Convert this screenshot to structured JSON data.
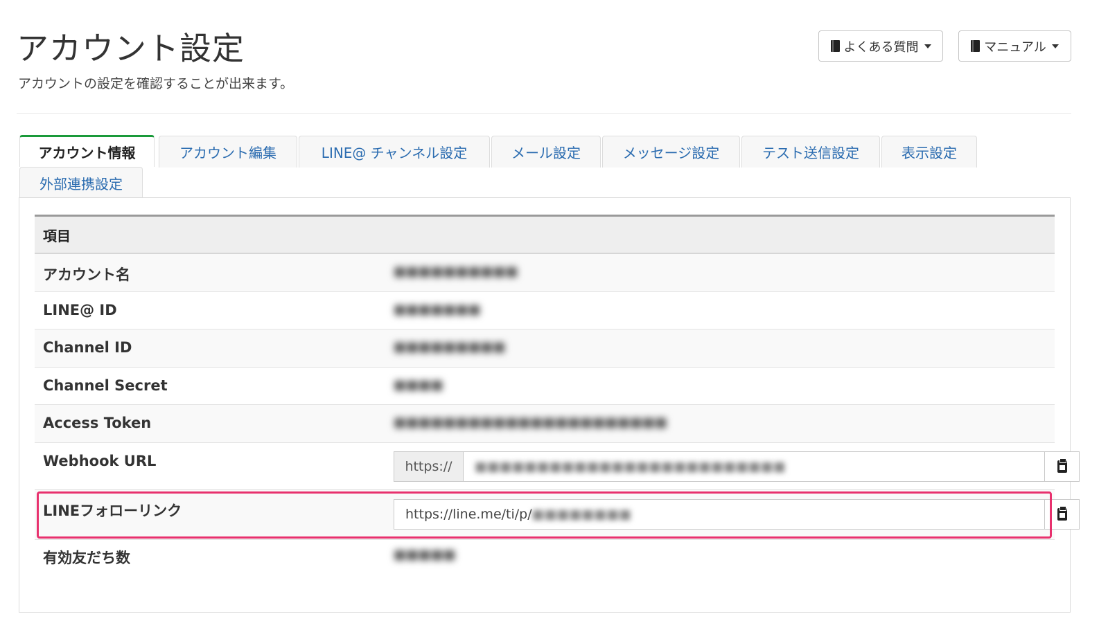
{
  "header": {
    "title": "アカウント設定",
    "description": "アカウントの設定を確認することが出来ます。",
    "faq_label": "よくある質問",
    "manual_label": "マニュアル"
  },
  "tabs": [
    {
      "label": "アカウント情報",
      "active": true
    },
    {
      "label": "アカウント編集"
    },
    {
      "label": "LINE@ チャンネル設定"
    },
    {
      "label": "メール設定"
    },
    {
      "label": "メッセージ設定"
    },
    {
      "label": "テスト送信設定"
    },
    {
      "label": "表示設定"
    },
    {
      "label": "外部連携設定"
    }
  ],
  "table": {
    "header": "項目",
    "rows": [
      {
        "label": "アカウント名",
        "value": "■■■■■■■■■■"
      },
      {
        "label": "LINE@ ID",
        "value": "■■■■■■■"
      },
      {
        "label": "Channel ID",
        "value": "■■■■■■■■■"
      },
      {
        "label": "Channel Secret",
        "value": "■■■■"
      },
      {
        "label": "Access Token",
        "value": "■■■■■■■■■■■■■■■■■■■■■■"
      },
      {
        "label": "Webhook URL",
        "prefix": "https://",
        "value": "■■■■■■■■■■■■■■■■■■■■■■■■■"
      },
      {
        "label": "LINEフォローリンク",
        "value": "https://line.me/ti/p/",
        "blurred_suffix": "■■■■■■■■"
      },
      {
        "label": "有効友だち数",
        "value": "■■■■■"
      }
    ]
  },
  "colors": {
    "active_tab_accent": "#1a9a3a",
    "link_blue": "#2b6cb0",
    "highlight": "#e8316e"
  }
}
